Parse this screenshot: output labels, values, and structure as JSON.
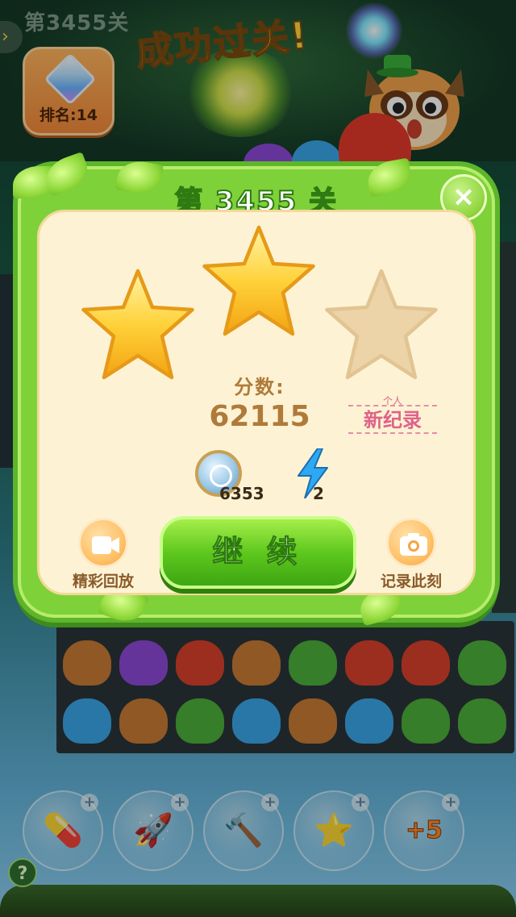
{
  "background": {
    "level_text": "第3455关",
    "rank": {
      "label": "排名:14"
    },
    "success_banner": "成功过关!"
  },
  "result": {
    "title": "第 3455 关",
    "stars_earned": 2,
    "stars_total": 3,
    "score_label": "分数:",
    "score_value": "62115",
    "record": {
      "small": "个人",
      "main": "新纪录"
    },
    "coins": "6353",
    "energy": "2",
    "replay_label": "精彩回放",
    "continue_label": "继 续",
    "record_moment_label": "记录此刻",
    "close_icon": "close-icon"
  },
  "boosters": [
    {
      "name": "rocket-pill-booster",
      "glyph": "💊"
    },
    {
      "name": "rocket-booster",
      "glyph": "🚀"
    },
    {
      "name": "hammer-booster",
      "glyph": "🔨"
    },
    {
      "name": "star-wand-booster",
      "glyph": "⭐"
    },
    {
      "name": "plus5-moves-booster",
      "text": "+5"
    }
  ],
  "colors": {
    "panel_green": "#7fd13a",
    "panel_cream": "#fdf3d4",
    "button_green": "#5ec81e",
    "score_brown": "#b07a3a",
    "record_pink": "#e0628a",
    "title_yellow": "#ffd83c"
  }
}
